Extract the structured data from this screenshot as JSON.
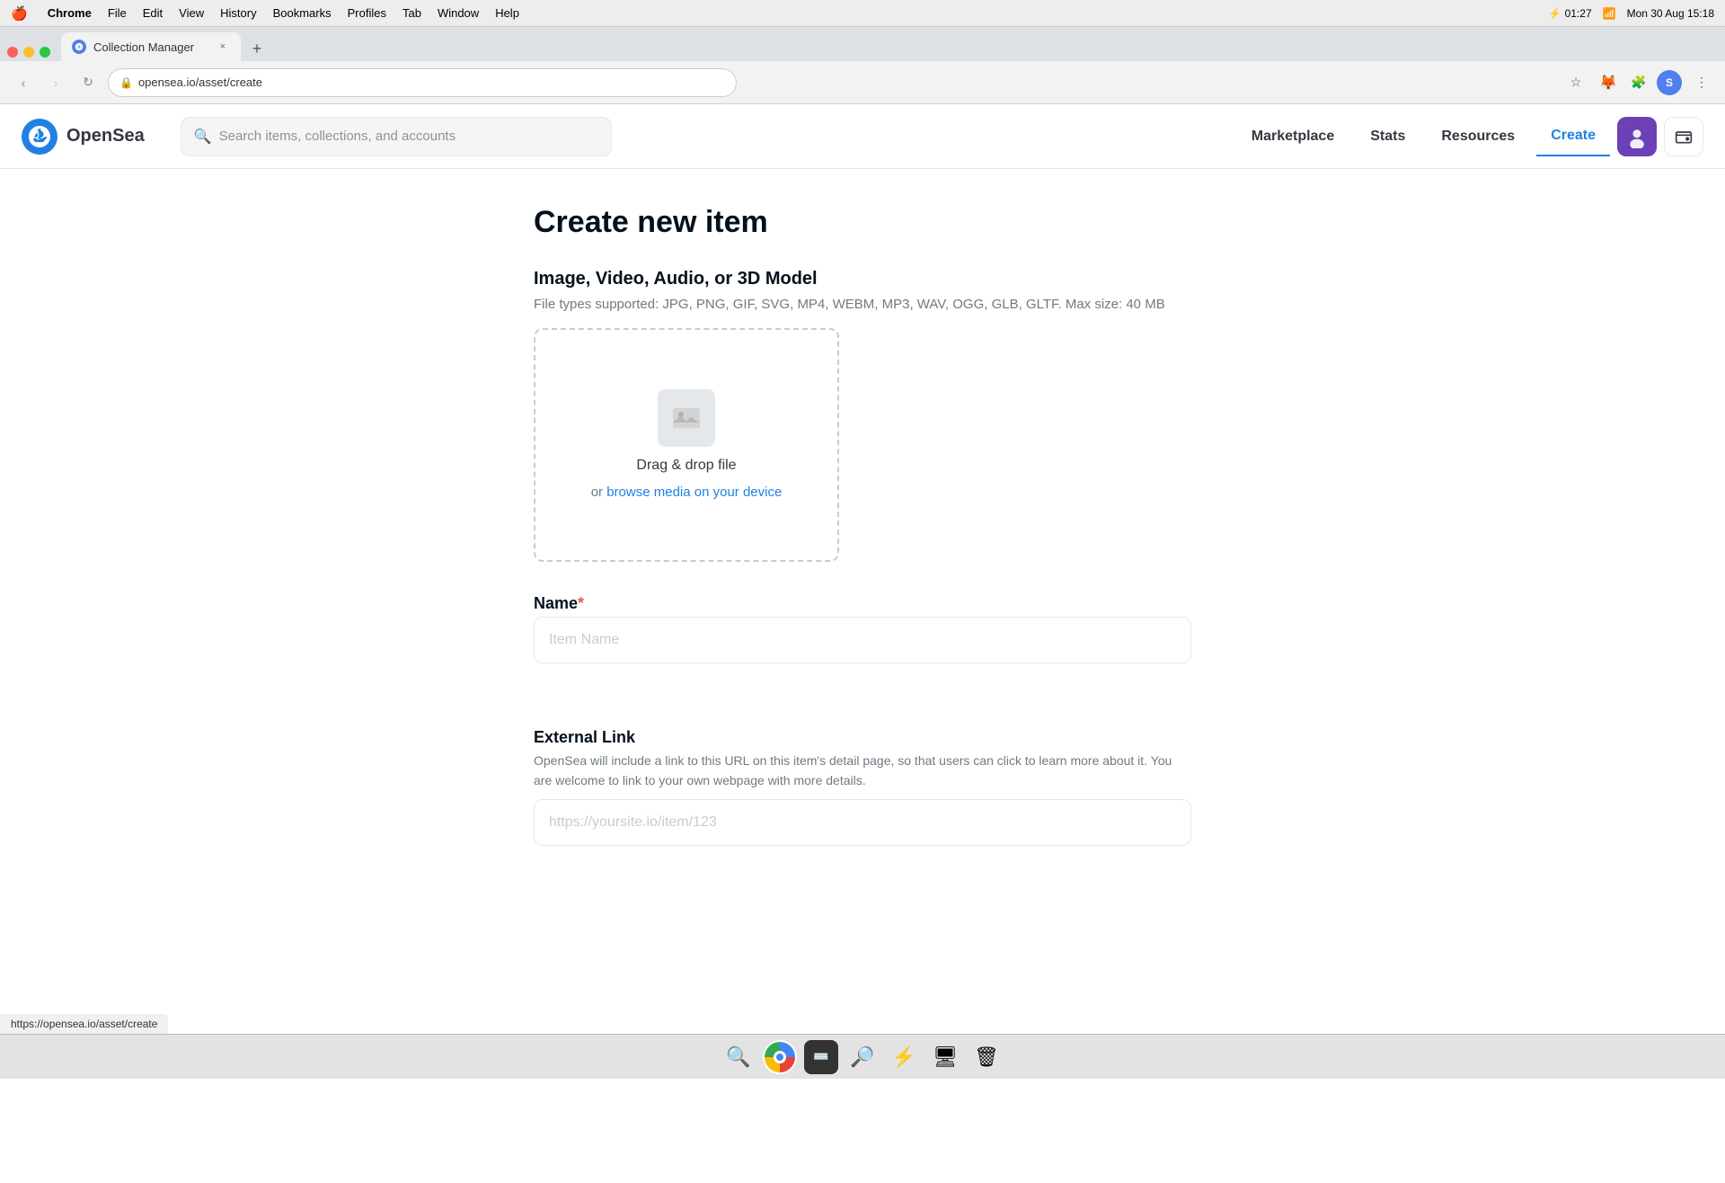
{
  "macos": {
    "menubar": {
      "apple": "🍎",
      "items": [
        "Chrome",
        "File",
        "Edit",
        "View",
        "History",
        "Bookmarks",
        "Profiles",
        "Tab",
        "Window",
        "Help"
      ],
      "bold_item": "Chrome",
      "time": "Mon 30 Aug  15:18",
      "battery_icon": "🔋",
      "battery_time": "01:27"
    },
    "dock": {
      "icons": [
        "🔍",
        "🌐",
        "📂",
        "🔎",
        "⚡",
        "🖥",
        "🗑"
      ]
    }
  },
  "browser": {
    "tab": {
      "title": "Collection Manager",
      "favicon_letter": "⛵"
    },
    "address": "opensea.io/asset/create",
    "status_url": "https://opensea.io/asset/create"
  },
  "opensea": {
    "logo_text": "OpenSea",
    "search_placeholder": "Search items, collections, and accounts",
    "nav": {
      "marketplace": "Marketplace",
      "stats": "Stats",
      "resources": "Resources",
      "create": "Create"
    }
  },
  "page": {
    "title": "Create new item",
    "upload": {
      "section_title": "Image, Video, Audio, or 3D Model",
      "file_types": "File types supported: JPG, PNG, GIF, SVG, MP4, WEBM, MP3, WAV, OGG, GLB, GLTF. Max size: 40 MB",
      "drag_text": "Drag & drop file",
      "or_text": "or ",
      "browse_link": "browse media on your device"
    },
    "name_field": {
      "label": "Name",
      "required": "*",
      "placeholder": "Item Name"
    },
    "external_link_field": {
      "label": "External Link",
      "description": "OpenSea will include a link to this URL on this item's detail page, so that users can click to learn more about it. You are welcome to link to your own webpage with more details.",
      "placeholder": "https://yoursite.io/item/123"
    }
  }
}
